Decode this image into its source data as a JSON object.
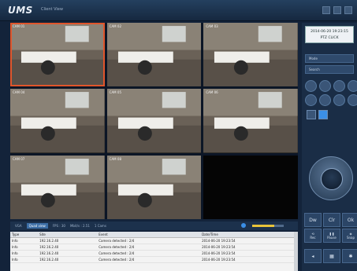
{
  "app": {
    "logo": "UMS",
    "subtitle": "Client View"
  },
  "video_grid": {
    "cameras": [
      {
        "label": "CAM 01"
      },
      {
        "label": "CAM 02"
      },
      {
        "label": "CAM 03"
      },
      {
        "label": "CAM 04"
      },
      {
        "label": "CAM 05"
      },
      {
        "label": "CAM 06"
      },
      {
        "label": "CAM 07"
      },
      {
        "label": "CAM 08"
      },
      {
        "label": ""
      }
    ]
  },
  "statusbar": {
    "items": [
      "VGA",
      "Quad view",
      "FPS : 30",
      "Mbit/s : 2.51",
      "1 Cams"
    ]
  },
  "log": {
    "columns": [
      "Type",
      "Site",
      "Event",
      "Date/Time"
    ],
    "rows": [
      [
        "Info",
        "192.16.2.40",
        "Camera detected : 2/4",
        "2014-06-20 19:23:54"
      ],
      [
        "Info",
        "192.16.2.40",
        "Camera detected : 2/4",
        "2014-06-20 19:23:54"
      ],
      [
        "Info",
        "192.16.2.40",
        "Camera detected : 2/4",
        "2014-06-20 19:23:54"
      ],
      [
        "Info",
        "192.16.2.40",
        "Camera detected : 2/4",
        "2014-06-20 19:23:54"
      ]
    ]
  },
  "panel": {
    "date": "2014-06-20 19:23:15",
    "date_sub": "PTZ CLICK",
    "buttons": [
      "Mode",
      "Search"
    ],
    "ctrl_labels": [
      "Dw",
      "Clr",
      "Ok"
    ],
    "bottom_labels": [
      "Rec",
      "Pause",
      "Snap"
    ]
  }
}
